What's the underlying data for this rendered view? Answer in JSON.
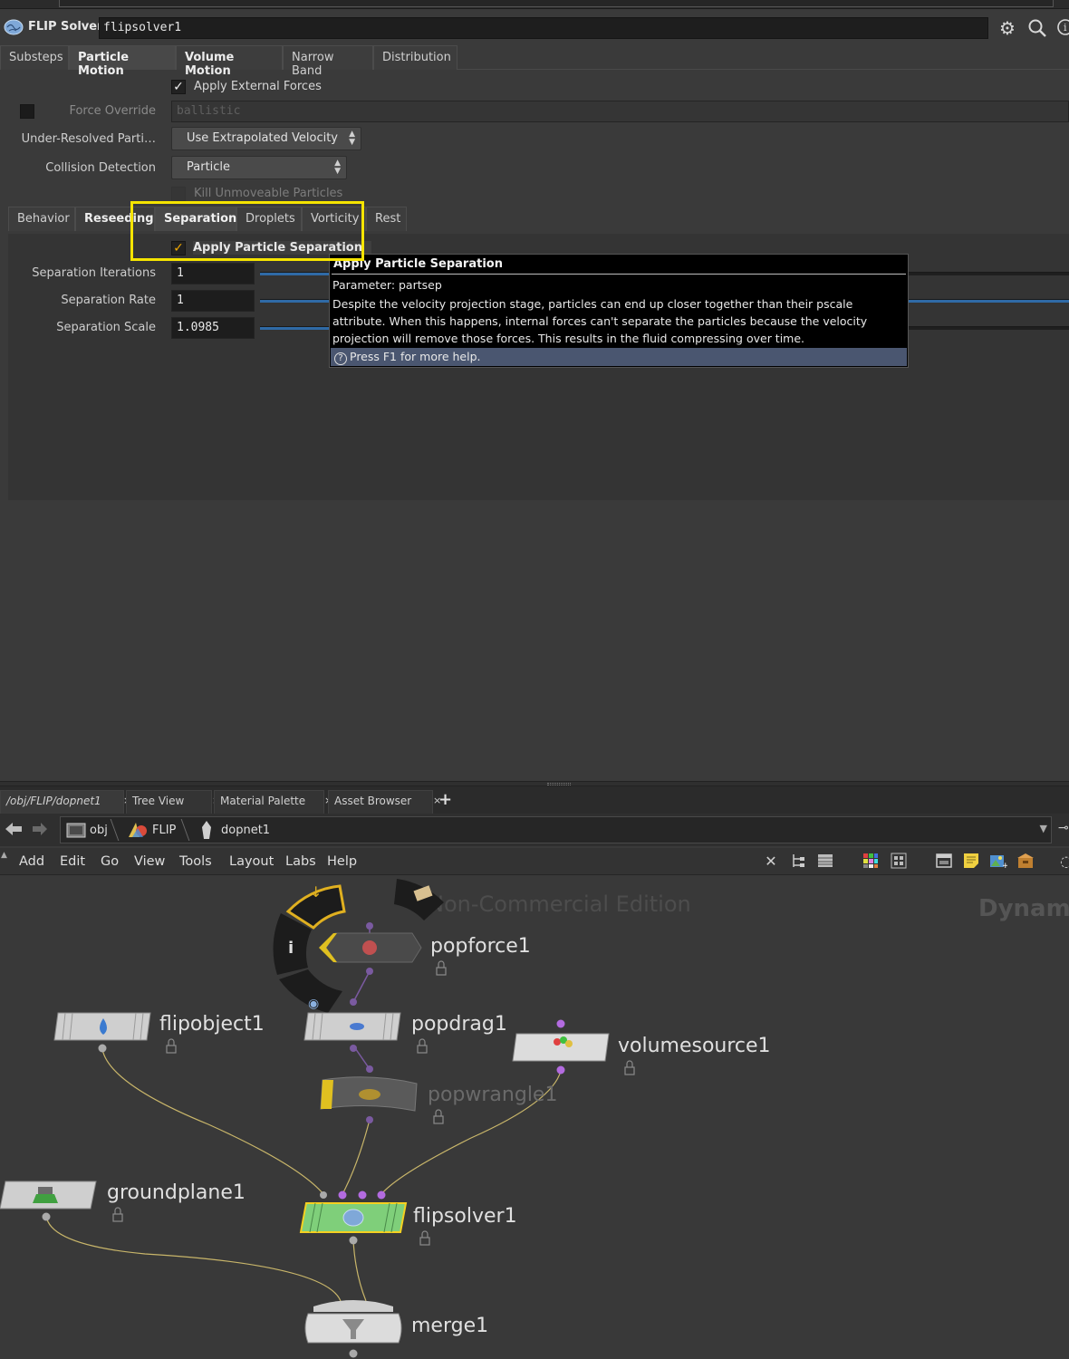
{
  "header": {
    "type_label": "FLIP Solver",
    "node_name": "flipsolver1"
  },
  "tabs": [
    {
      "label": "Substeps"
    },
    {
      "label": "Particle Motion"
    },
    {
      "label": "Volume Motion"
    },
    {
      "label": "Narrow Band"
    },
    {
      "label": "Distribution"
    }
  ],
  "params": {
    "apply_external_forces": {
      "label": "Apply External Forces",
      "checked": true
    },
    "force_override": {
      "label": "Force Override",
      "value": "ballistic"
    },
    "under_resolved": {
      "label": "Under-Resolved Parti…",
      "value": "Use Extrapolated Velocity"
    },
    "collision_detection": {
      "label": "Collision Detection",
      "value": "Particle"
    },
    "kill_unmoveable": {
      "label": "Kill Unmoveable Particles"
    }
  },
  "subtabs": [
    {
      "label": "Behavior"
    },
    {
      "label": "Reseeding"
    },
    {
      "label": "Separation"
    },
    {
      "label": "Droplets"
    },
    {
      "label": "Vorticity"
    },
    {
      "label": "Rest"
    }
  ],
  "separation": {
    "apply_label": "Apply Particle Separation",
    "iterations": {
      "label": "Separation Iterations",
      "value": "1"
    },
    "rate": {
      "label": "Separation Rate",
      "value": "1"
    },
    "scale": {
      "label": "Separation Scale",
      "value": "1.0985"
    }
  },
  "tooltip": {
    "title": "Apply Particle Separation",
    "param": "Parameter: partsep",
    "body": "Despite the velocity projection stage, particles can end up closer together than their pscale attribute. When this happens, internal forces can't separate the particles because the velocity projection will remove those forces. This results in the fluid compressing over time.",
    "help": "Press F1 for more help."
  },
  "pane_tabs": [
    {
      "label": "/obj/FLIP/dopnet1"
    },
    {
      "label": "Tree View"
    },
    {
      "label": "Material Palette"
    },
    {
      "label": "Asset Browser"
    }
  ],
  "path": {
    "crumbs": [
      "obj",
      "FLIP",
      "dopnet1"
    ]
  },
  "menus": [
    "Add",
    "Edit",
    "Go",
    "View",
    "Tools",
    "Layout",
    "Labs",
    "Help"
  ],
  "network": {
    "watermark": "Non-Commercial Edition",
    "context_label": "Dynam",
    "nodes": {
      "popforce": "popforce1",
      "flipobject": "flipobject1",
      "popdrag": "popdrag1",
      "volumesource": "volumesource1",
      "popwrangle": "popwrangle1",
      "groundplane": "groundplane1",
      "flipsolver": "flipsolver1",
      "merge": "merge1"
    }
  },
  "colors": {
    "highlight": "#f5e400",
    "solver_node": "#7fcf7a",
    "slider": "#2f6aa6",
    "wire_yellow": "#c9b66a",
    "input_dot": "#b36be0"
  }
}
